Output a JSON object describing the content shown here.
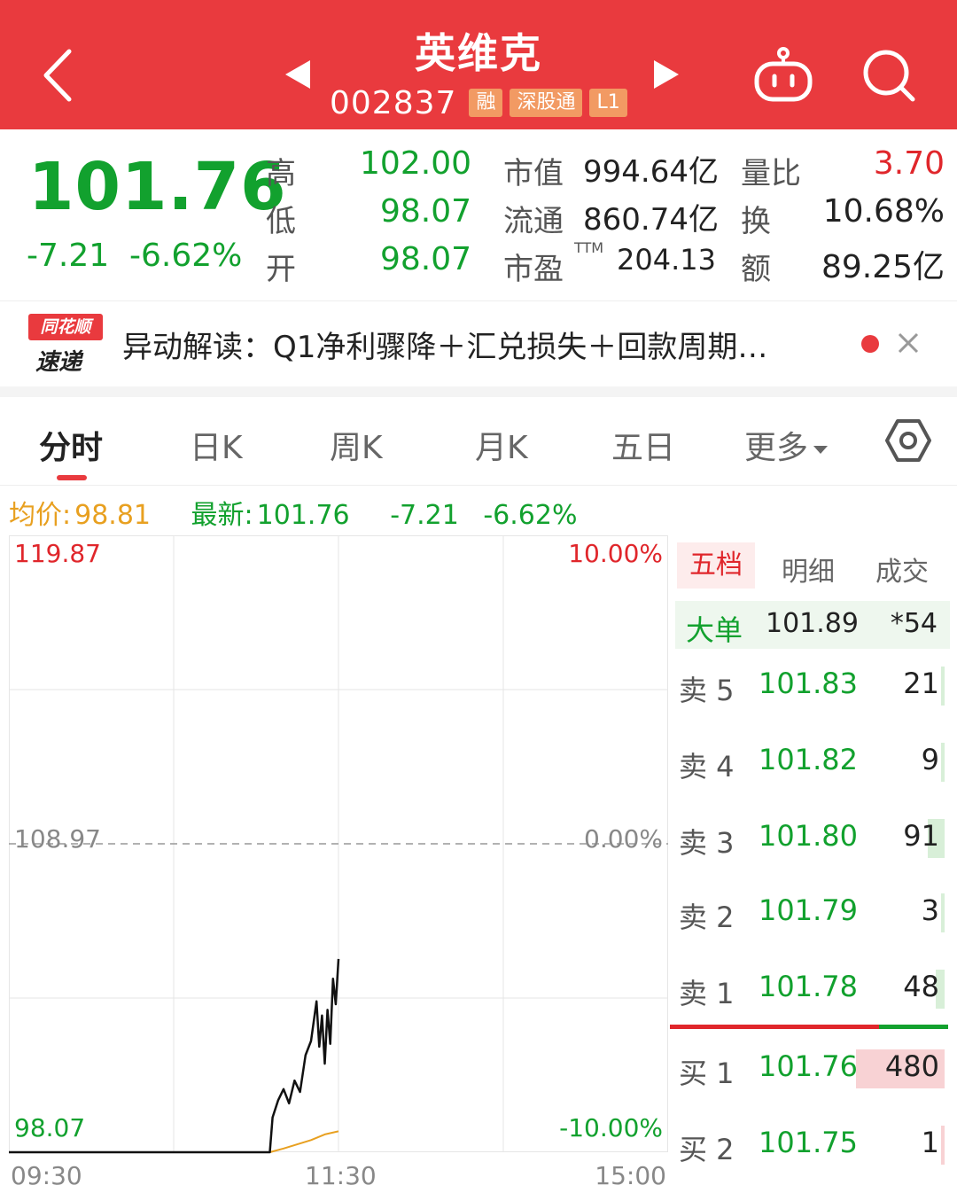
{
  "header": {
    "title": "英维克",
    "code": "002837",
    "tags": [
      "融",
      "深股通",
      "L1"
    ],
    "bg_color": "#e93a3e"
  },
  "quote": {
    "price": "101.76",
    "change": "-7.21",
    "change_pct": "-6.62%",
    "high_label": "高",
    "high": "102.00",
    "low_label": "低",
    "low": "98.07",
    "open_label": "开",
    "open": "98.07",
    "mktcap_label": "市值",
    "mktcap": "994.64亿",
    "float_label": "流通",
    "float": "860.74亿",
    "pe_label": "市盈",
    "pe_sup": "TTM",
    "pe": "204.13",
    "volratio_label": "量比",
    "volratio": "3.70",
    "turnover_label": "换",
    "turnover": "10.68%",
    "amount_label": "额",
    "amount": "89.25亿"
  },
  "news": {
    "logo_top": "同花顺",
    "logo_bottom": "速递",
    "text": "异动解读：Q1净利骤降＋汇兑损失＋回款周期…"
  },
  "tabs": {
    "items": [
      "分时",
      "日K",
      "周K",
      "月K",
      "五日",
      "更多"
    ],
    "active": "分时"
  },
  "info": {
    "avg_label": "均价:",
    "avg": "98.81",
    "latest_label": "最新:",
    "latest": "101.76",
    "change": "-7.21",
    "change_pct": "-6.62%"
  },
  "chart_data": {
    "type": "line",
    "y_max_label": "119.87",
    "y_mid_label": "108.97",
    "y_min_label": "98.07",
    "pct_max_label": "10.00%",
    "pct_mid_label": "0.00%",
    "pct_min_label": "-10.00%",
    "x_labels": [
      "09:30",
      "11:30",
      "15:00"
    ],
    "ylim": [
      98.07,
      119.87
    ],
    "prev_close": 108.97,
    "series": [
      {
        "name": "最新",
        "color": "#111111",
        "x": [
          0,
          80,
          95,
          96,
          98,
          100,
          102,
          104,
          106,
          108,
          110,
          112,
          113,
          114,
          115,
          116,
          117,
          118,
          119,
          120
        ],
        "values": [
          98.07,
          98.07,
          98.07,
          99.3,
          99.9,
          100.3,
          99.8,
          100.6,
          100.2,
          101.5,
          102.0,
          103.4,
          101.8,
          102.9,
          101.2,
          103.1,
          101.9,
          104.2,
          103.3,
          104.9
        ]
      },
      {
        "name": "均价",
        "color": "#e8a020",
        "x": [
          0,
          95,
          100,
          105,
          110,
          115,
          120
        ],
        "values": [
          98.07,
          98.07,
          98.2,
          98.35,
          98.5,
          98.7,
          98.81
        ]
      }
    ],
    "x_total_minutes": 240
  },
  "orderbook": {
    "tabs": [
      "五档",
      "明细",
      "成交"
    ],
    "big_order": {
      "label": "大单",
      "price": "101.89",
      "vol": "*54"
    },
    "asks": [
      {
        "label": "卖 5",
        "price": "101.83",
        "vol": "21"
      },
      {
        "label": "卖 4",
        "price": "101.82",
        "vol": "9"
      },
      {
        "label": "卖 3",
        "price": "101.80",
        "vol": "91"
      },
      {
        "label": "卖 2",
        "price": "101.79",
        "vol": "3"
      },
      {
        "label": "卖 1",
        "price": "101.78",
        "vol": "48"
      }
    ],
    "bids": [
      {
        "label": "买 1",
        "price": "101.76",
        "vol": "480"
      },
      {
        "label": "买 2",
        "price": "101.75",
        "vol": "1"
      }
    ],
    "buy_ratio": 0.75
  }
}
